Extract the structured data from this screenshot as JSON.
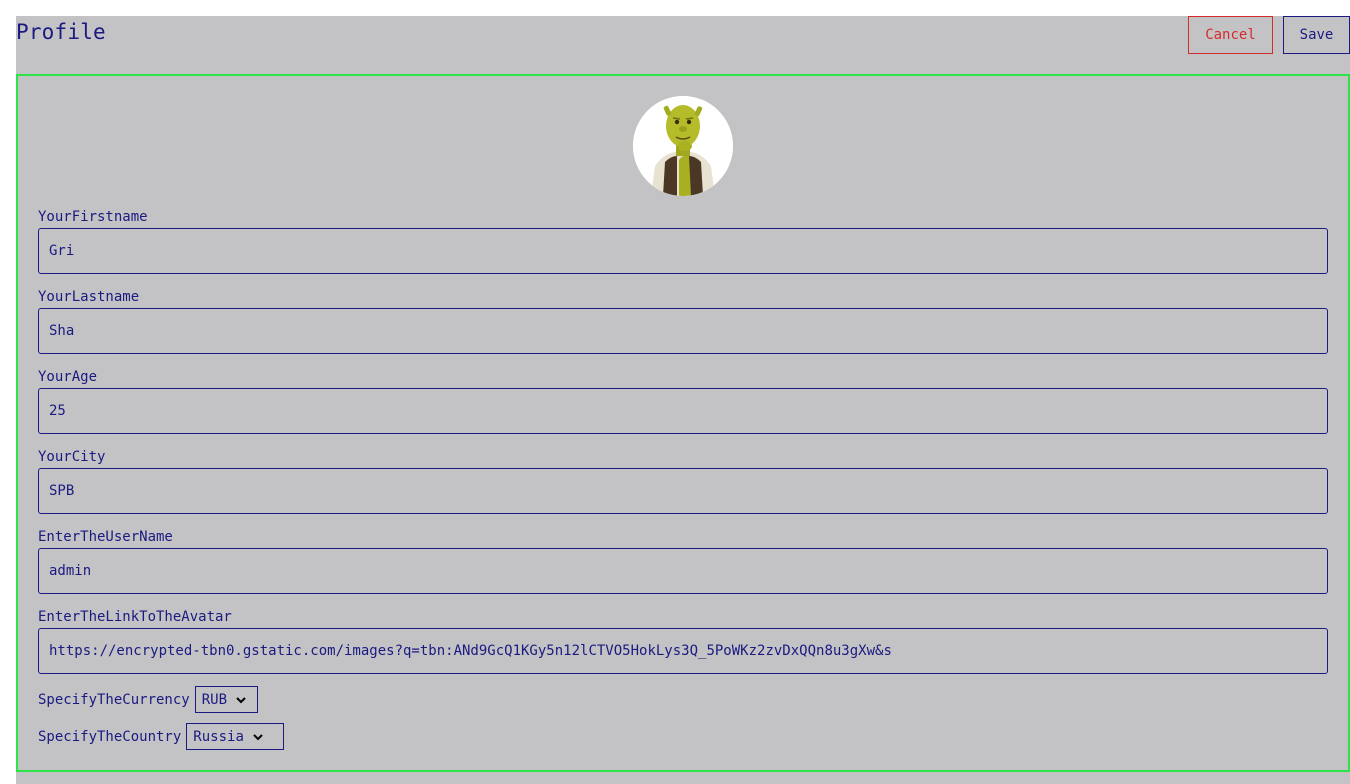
{
  "header": {
    "title": "Profile",
    "cancel_label": "Cancel",
    "save_label": "Save"
  },
  "form": {
    "fields": [
      {
        "label": "YourFirstname",
        "value": "Gri"
      },
      {
        "label": "YourLastname",
        "value": "Sha"
      },
      {
        "label": "YourAge",
        "value": "25"
      },
      {
        "label": "YourCity",
        "value": "SPB"
      },
      {
        "label": "EnterTheUserName",
        "value": "admin"
      },
      {
        "label": "EnterTheLinkToTheAvatar",
        "value": "https://encrypted-tbn0.gstatic.com/images?q=tbn:ANd9GcQ1KGy5n12lCTVO5HokLys3Q_5PoWKz2zvDxQQn8u3gXw&s"
      }
    ],
    "currency": {
      "label": "SpecifyTheCurrency",
      "selected": "RUB"
    },
    "country": {
      "label": "SpecifyTheCountry",
      "selected": "Russia"
    }
  },
  "colors": {
    "background": "#c3c3c6",
    "primary": "#1a1a80",
    "danger": "#d42b2b",
    "card_border": "#2ee24a"
  },
  "icons": {
    "avatar": "ogre-character-avatar",
    "select_arrow": "chevron-down-icon"
  }
}
